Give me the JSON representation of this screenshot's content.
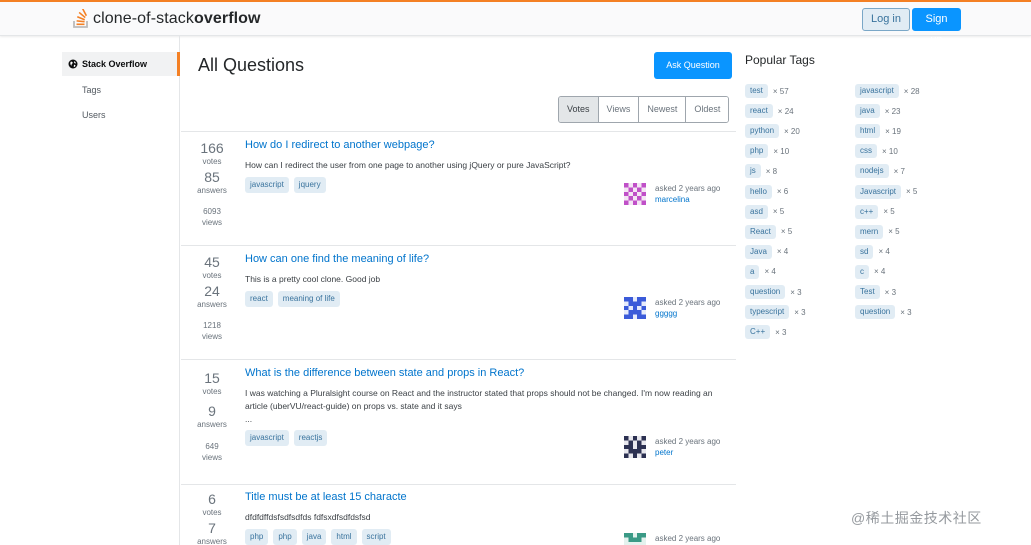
{
  "header": {
    "brand_regular": "clone-of-stack",
    "brand_bold": "overflow",
    "login_label": "Log in",
    "signup_label": "Sign up"
  },
  "sidebar": {
    "items": [
      {
        "label": "Stack Overflow",
        "icon": "globe-icon",
        "active": true
      },
      {
        "label": "Tags"
      },
      {
        "label": "Users"
      }
    ]
  },
  "main": {
    "title": "All Questions",
    "ask_label": "Ask Question",
    "filters": [
      "Votes",
      "Views",
      "Newest",
      "Oldest"
    ],
    "active_filter": "Votes",
    "questions": [
      {
        "votes": "166",
        "votes_label": "votes",
        "answers": "85",
        "answers_label": "answers",
        "views": "6093",
        "views_label": "views",
        "title": "How do I redirect to another webpage?",
        "excerpt": "How can I redirect the user from one page to another using jQuery or pure JavaScript?",
        "tags": [
          "javascript",
          "jquery"
        ],
        "asked": "asked 2 years ago",
        "user": "marcelina"
      },
      {
        "votes": "45",
        "votes_label": "votes",
        "answers": "24",
        "answers_label": "answers",
        "views": "1218",
        "views_label": "views",
        "title": "How can one find the meaning of life?",
        "excerpt": "This is a pretty cool clone. Good job",
        "tags": [
          "react",
          "meaning of life"
        ],
        "asked": "asked 2 years ago",
        "user": "ggggg"
      },
      {
        "votes": "15",
        "votes_label": "votes",
        "answers": "9",
        "answers_label": "answers",
        "views": "649",
        "views_label": "views",
        "title": "What is the difference between state and props in React?",
        "excerpt": "I was watching a Pluralsight course on React and the instructor stated that props should not be changed. I'm now reading an article (uberVU/react-guide) on props vs. state and it says",
        "excerpt_more": "...",
        "tags": [
          "javascript",
          "reactjs"
        ],
        "asked": "asked 2 years ago",
        "user": "peter"
      },
      {
        "votes": "6",
        "votes_label": "votes",
        "answers": "7",
        "answers_label": "answers",
        "title": "Title must be at least 15 characte",
        "excerpt": "dfdfdffdsfsdfsdfds fdfsxdfsdfdsfsd",
        "tags": [
          "php",
          "php",
          "java",
          "html",
          "script"
        ],
        "asked": "asked 2 years ago"
      }
    ]
  },
  "popular_tags": {
    "title": "Popular Tags",
    "left": [
      {
        "name": "test",
        "count": "× 57"
      },
      {
        "name": "react",
        "count": "× 24"
      },
      {
        "name": "python",
        "count": "× 20"
      },
      {
        "name": "php",
        "count": "× 10"
      },
      {
        "name": "js",
        "count": "× 8"
      },
      {
        "name": "hello",
        "count": "× 6"
      },
      {
        "name": "asd",
        "count": "× 5"
      },
      {
        "name": "React",
        "count": "× 5"
      },
      {
        "name": "Java",
        "count": "× 4"
      },
      {
        "name": "a",
        "count": "× 4"
      },
      {
        "name": "question",
        "count": "× 3"
      },
      {
        "name": "typescript",
        "count": "× 3"
      },
      {
        "name": "C++",
        "count": "× 3"
      }
    ],
    "right": [
      {
        "name": "javascript",
        "count": "× 28"
      },
      {
        "name": "java",
        "count": "× 23"
      },
      {
        "name": "html",
        "count": "× 19"
      },
      {
        "name": "css",
        "count": "× 10"
      },
      {
        "name": "nodejs",
        "count": "× 7"
      },
      {
        "name": "Javascript",
        "count": "× 5"
      },
      {
        "name": "c++",
        "count": "× 5"
      },
      {
        "name": "mern",
        "count": "× 5"
      },
      {
        "name": "sd",
        "count": "× 4"
      },
      {
        "name": "c",
        "count": "× 4"
      },
      {
        "name": "Test",
        "count": "× 3"
      },
      {
        "name": "question",
        "count": "× 3"
      }
    ]
  },
  "watermark": "@稀土掘金技术社区",
  "colors": {
    "accent": "#f48024",
    "link": "#0074cc",
    "primary_button": "#0a95ff",
    "tag_bg": "#e1ecf4",
    "tag_text": "#39739d"
  }
}
